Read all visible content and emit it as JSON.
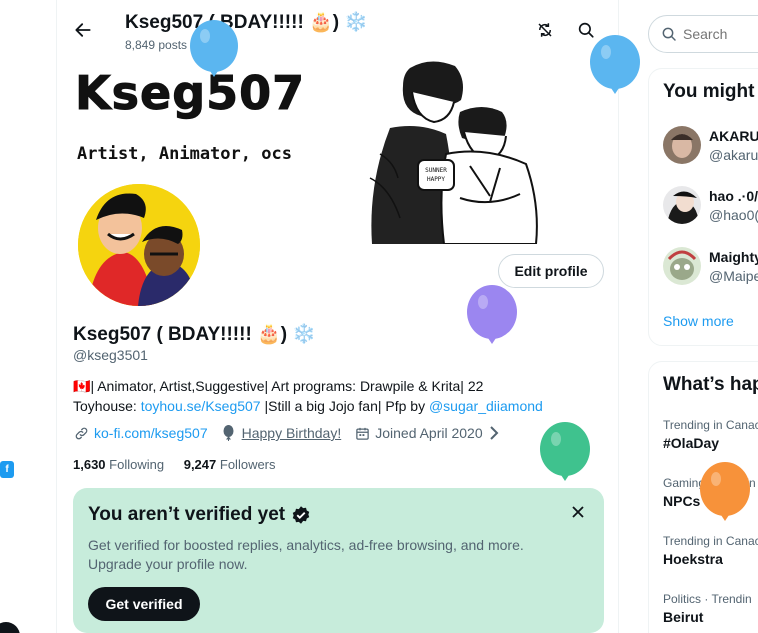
{
  "header": {
    "title": "Kseg507 ( BDAY!!!!! 🎂) ❄️",
    "posts": "8,849 posts"
  },
  "banner": {
    "logo": "Kseg507",
    "tagline": "Artist, Animator, ocs",
    "cup_text": "SUNNER\nHAPPY"
  },
  "profile": {
    "name": "Kseg507 ( BDAY!!!!! 🎂) ❄️",
    "handle": "@kseg3501",
    "edit_label": "Edit profile",
    "bio_flag": "🇨🇦",
    "bio_1": "| Animator, Artist,Suggestive| Art programs: Drawpile & Krita| 22",
    "bio_2_pre": "Toyhouse: ",
    "bio_2_link": "toyhou.se/Kseg507",
    "bio_2_mid": " |Still a big Jojo fan| Pfp by ",
    "bio_2_mention": "@sugar_diiamond",
    "website": "ko-fi.com/kseg507",
    "birthday": "Happy Birthday!",
    "joined": "Joined April 2020",
    "following_count": "1,630",
    "following_label": "Following",
    "followers_count": "9,247",
    "followers_label": "Followers"
  },
  "verify": {
    "title": "You aren’t verified yet",
    "desc": "Get verified for boosted replies, analytics, ad-free browsing, and more. Upgrade your profile now.",
    "button": "Get verified"
  },
  "left": {
    "badge": "f"
  },
  "sidebar": {
    "search_placeholder": "Search",
    "who_to_follow": "You might",
    "suggestions": [
      {
        "name": "AKARU",
        "handle": "@akaru"
      },
      {
        "name": "hao .·0/",
        "handle": "@hao0("
      },
      {
        "name": "Maighty",
        "handle": "@Maipe"
      }
    ],
    "show_more": "Show more",
    "trends_title": "What’s hap",
    "trends": [
      {
        "context": "Trending in Canac",
        "title": "#OlaDay"
      },
      {
        "context": "Gaming · Trendin",
        "title": "NPCs"
      },
      {
        "context": "Trending in Canac",
        "title": "Hoekstra"
      },
      {
        "context": "Politics · Trendin",
        "title": "Beirut"
      }
    ]
  },
  "colors": {
    "accent": "#1d9bf0",
    "verify_bg": "#c7ecdb",
    "balloon_blue": "#5bb6f0",
    "balloon_purple": "#9b86f0",
    "balloon_green": "#3fc28e",
    "balloon_orange": "#f7923a",
    "avatar_yellow": "#f5d40f"
  }
}
